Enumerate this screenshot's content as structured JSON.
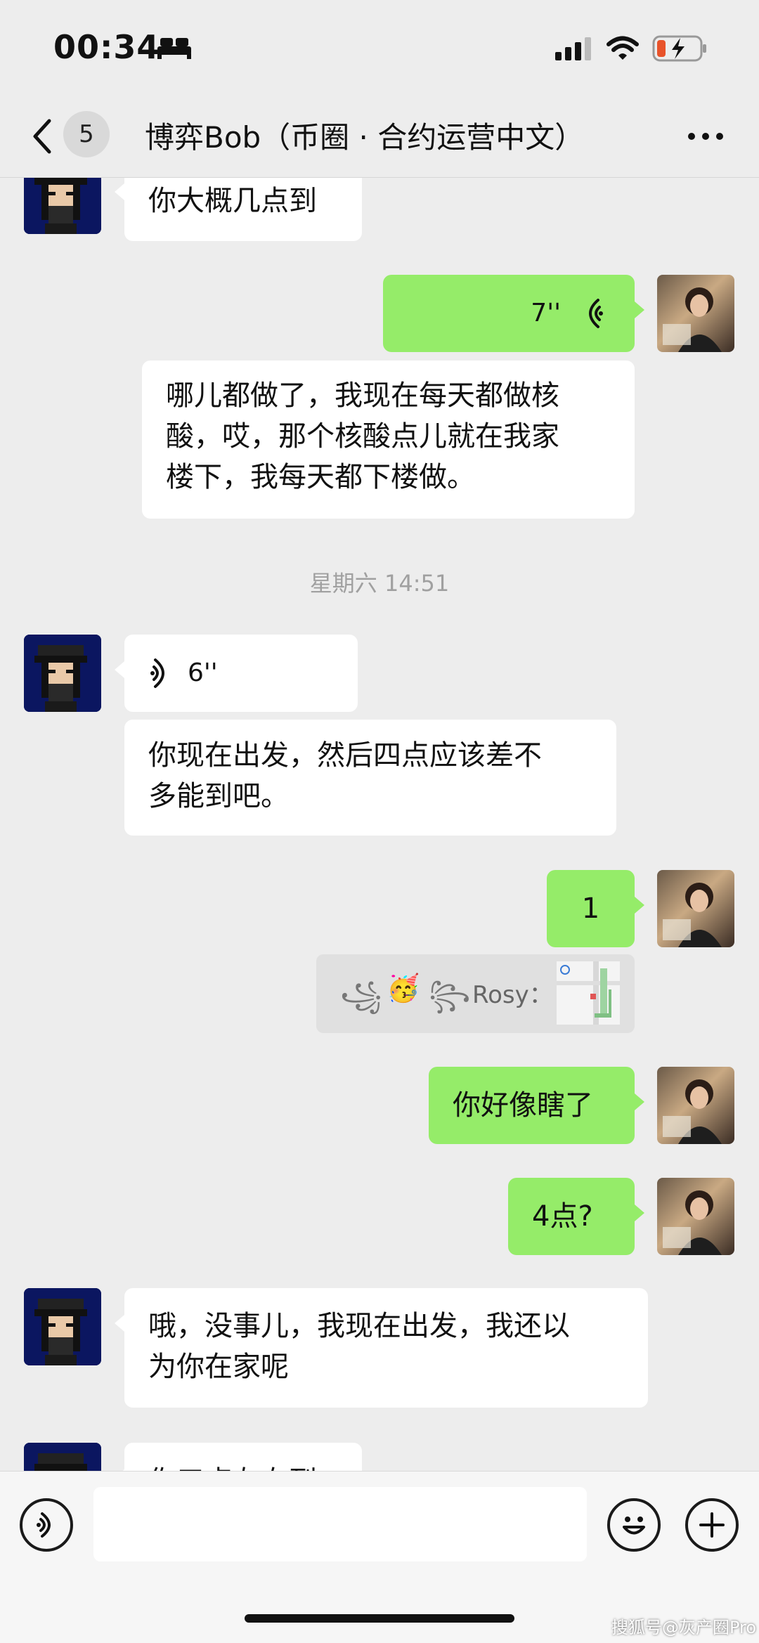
{
  "status_bar": {
    "time": "00:34",
    "icons": [
      "sleep-bed-icon",
      "cellular-signal-icon",
      "wifi-icon",
      "battery-charging-icon"
    ]
  },
  "nav": {
    "unread_count": "5",
    "title": "博弈Bob（币圈 · 合约运营中文）",
    "icons": [
      "back-chevron-icon",
      "more-dots-icon"
    ]
  },
  "messages": {
    "m1": {
      "text": "你大概几点到"
    },
    "m2": {
      "duration": "7''"
    },
    "m3": {
      "line1": "哪儿都做了，我现在每天都做核",
      "line2": "酸，哎，那个核酸点儿就在我家",
      "line3": "楼下，我每天都下楼做。"
    },
    "timestamp": "星期六 14:51",
    "m4": {
      "duration": "6''"
    },
    "m5": {
      "line1": "你现在出发，然后四点应该差不",
      "line2": "多能到吧。"
    },
    "m6": {
      "text": "1"
    },
    "m7": {
      "sender": "Rosy：",
      "decor_left": "꧁",
      "emoji": "🥳",
      "decor_right": "꧂"
    },
    "m8": {
      "text": "你好像瞎了"
    },
    "m9": {
      "text": "4点?"
    },
    "m10": {
      "line1": "哦，没事儿，我现在出发，我还以",
      "line2": "为你在家呢"
    },
    "m11": {
      "text": "你三点左右到"
    }
  },
  "bottom_bar": {
    "icons": [
      "voice-input-icon",
      "emoji-icon",
      "plus-icon"
    ]
  },
  "watermark": "搜狐号@灰产圈Pro"
}
